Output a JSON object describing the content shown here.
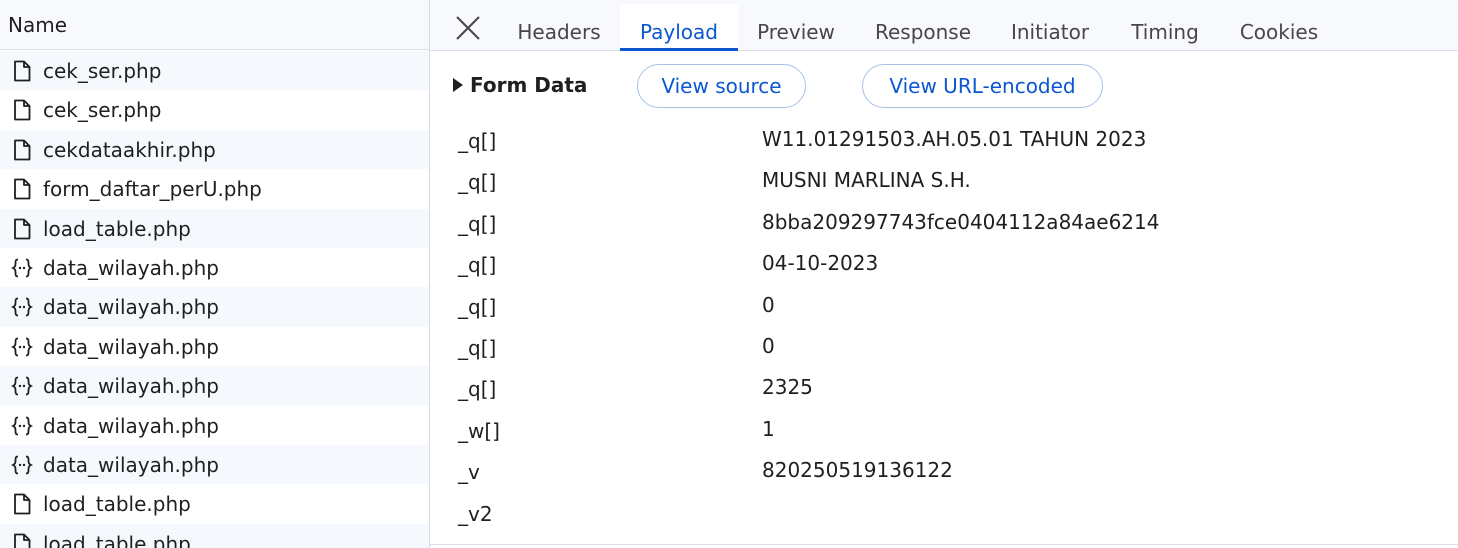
{
  "request_list": {
    "header": "Name",
    "rows": [
      {
        "name": "cek_ser.php",
        "icon": "document-icon"
      },
      {
        "name": "cek_ser.php",
        "icon": "document-icon"
      },
      {
        "name": "cekdataakhir.php",
        "icon": "document-icon"
      },
      {
        "name": "form_daftar_perU.php",
        "icon": "document-icon"
      },
      {
        "name": "load_table.php",
        "icon": "document-icon"
      },
      {
        "name": "data_wilayah.php",
        "icon": "json-braces-icon"
      },
      {
        "name": "data_wilayah.php",
        "icon": "json-braces-icon"
      },
      {
        "name": "data_wilayah.php",
        "icon": "json-braces-icon"
      },
      {
        "name": "data_wilayah.php",
        "icon": "json-braces-icon"
      },
      {
        "name": "data_wilayah.php",
        "icon": "json-braces-icon"
      },
      {
        "name": "data_wilayah.php",
        "icon": "json-braces-icon"
      },
      {
        "name": "load_table.php",
        "icon": "document-icon"
      },
      {
        "name": "load_table.php",
        "icon": "document-icon"
      }
    ]
  },
  "detail": {
    "close_icon": "close-icon",
    "tabs": [
      {
        "label": "Headers",
        "active": false
      },
      {
        "label": "Payload",
        "active": true
      },
      {
        "label": "Preview",
        "active": false
      },
      {
        "label": "Response",
        "active": false
      },
      {
        "label": "Initiator",
        "active": false
      },
      {
        "label": "Timing",
        "active": false
      },
      {
        "label": "Cookies",
        "active": false
      }
    ],
    "section": {
      "title": "Form Data",
      "view_source_label": "View source",
      "view_url_encoded_label": "View URL-encoded"
    },
    "form_data": [
      {
        "key": "_q[]",
        "value": "W11.01291503.AH.05.01 TAHUN 2023"
      },
      {
        "key": "_q[]",
        "value": "MUSNI MARLINA S.H."
      },
      {
        "key": "_q[]",
        "value": "8bba209297743fce0404112a84ae6214"
      },
      {
        "key": "_q[]",
        "value": "04-10-2023"
      },
      {
        "key": "_q[]",
        "value": "0"
      },
      {
        "key": "_q[]",
        "value": "0"
      },
      {
        "key": "_q[]",
        "value": "2325"
      },
      {
        "key": "_w[]",
        "value": "1"
      },
      {
        "key": "_v",
        "value": "820250519136122"
      },
      {
        "key": "_v2",
        "value": ""
      }
    ]
  },
  "colors": {
    "accent": "#0b57d0",
    "header_bg": "#f7f9fc",
    "row_alt_bg": "#f5f8fd",
    "border": "#d9e0ea"
  }
}
